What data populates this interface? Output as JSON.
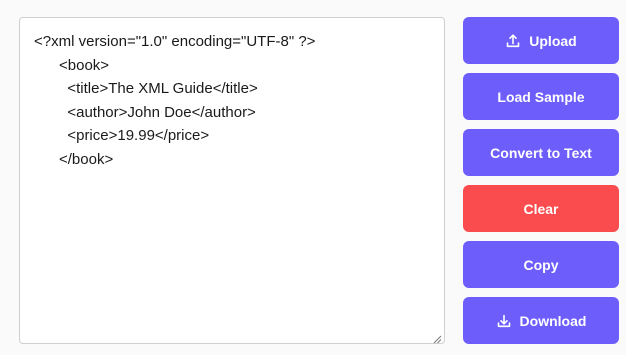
{
  "editor": {
    "content": "<?xml version=\"1.0\" encoding=\"UTF-8\" ?>\n      <book>\n        <title>The XML Guide</title>\n        <author>John Doe</author>\n        <price>19.99</price>\n      </book>"
  },
  "buttons": {
    "upload": {
      "label": "Upload",
      "icon": "upload-icon"
    },
    "load_sample": {
      "label": "Load Sample"
    },
    "convert": {
      "label": "Convert to Text"
    },
    "clear": {
      "label": "Clear"
    },
    "copy": {
      "label": "Copy"
    },
    "download": {
      "label": "Download",
      "icon": "download-icon"
    }
  },
  "colors": {
    "primary": "#6d5efc",
    "danger": "#fa4c4e"
  }
}
